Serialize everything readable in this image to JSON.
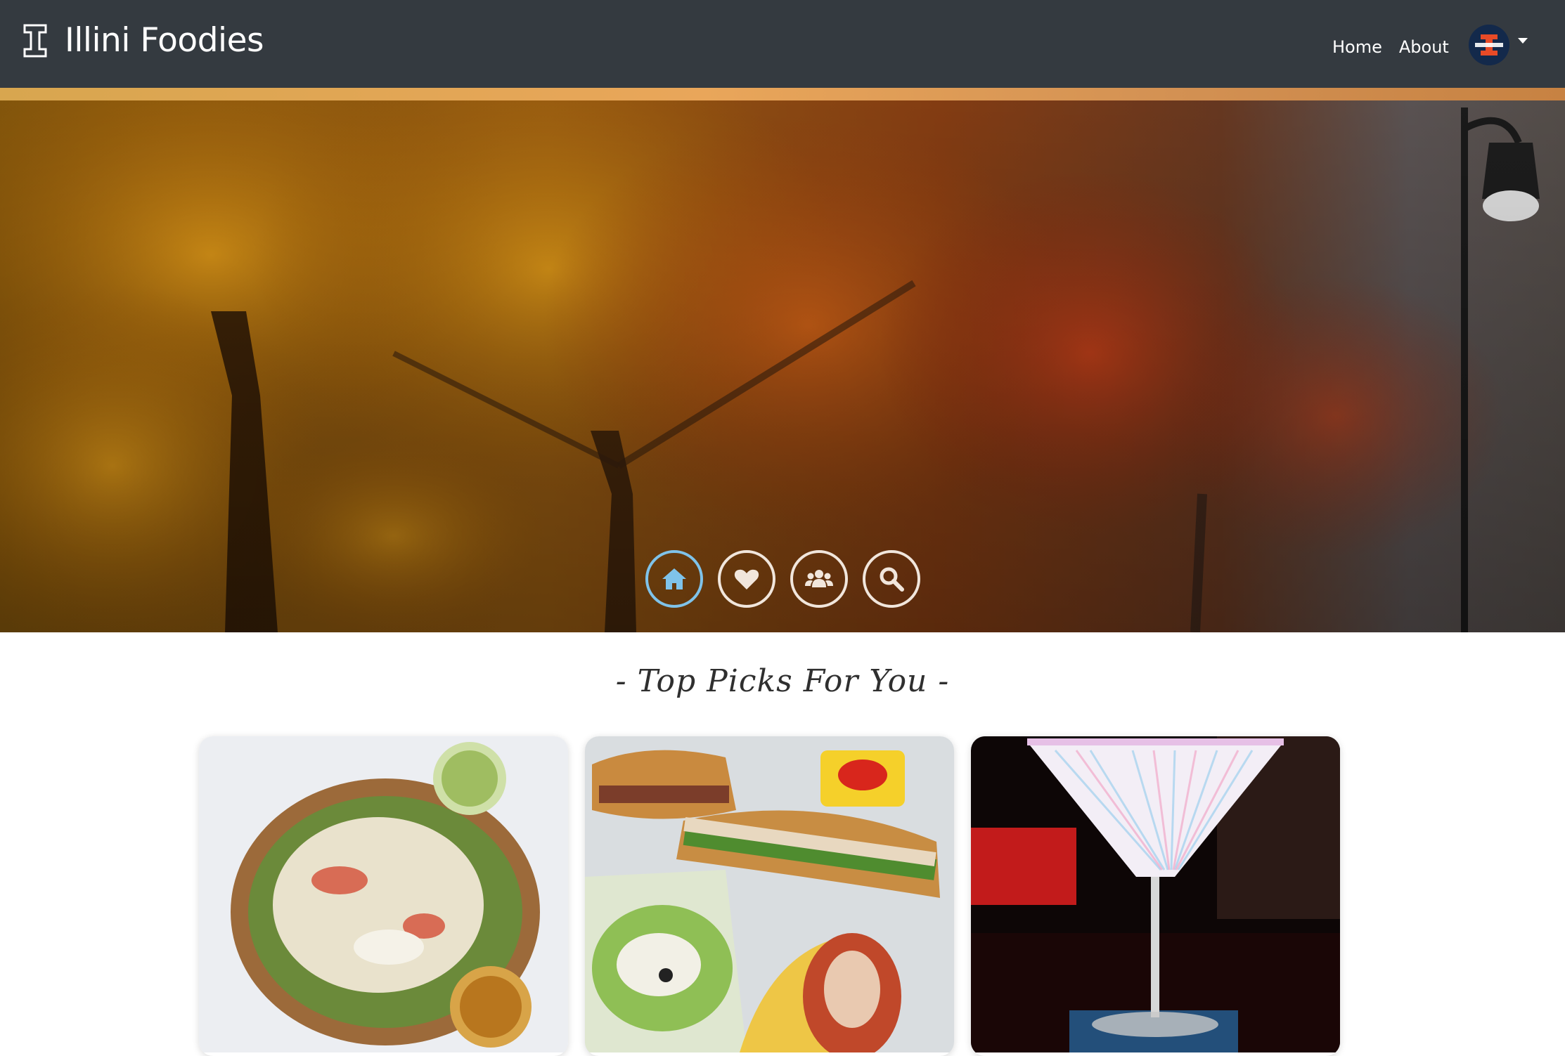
{
  "navbar": {
    "brand_title": "Illini Foodies",
    "links": [
      {
        "label": "Home"
      },
      {
        "label": "About"
      }
    ]
  },
  "hero": {
    "buttons": [
      {
        "name": "home",
        "icon": "home-icon",
        "active": true
      },
      {
        "name": "favorites",
        "icon": "heart-icon",
        "active": false
      },
      {
        "name": "friends",
        "icon": "users-icon",
        "active": false
      },
      {
        "name": "search",
        "icon": "search-icon",
        "active": false
      }
    ]
  },
  "section": {
    "title": "- Top Picks For You -"
  },
  "cards": [
    {
      "name": "tostada-photo"
    },
    {
      "name": "subway-sandwich-photo"
    },
    {
      "name": "martini-photo"
    }
  ],
  "colors": {
    "navbar_bg": "#343a40",
    "accent_active": "#7fc3ea",
    "hero_strip": "#e9a65a"
  }
}
